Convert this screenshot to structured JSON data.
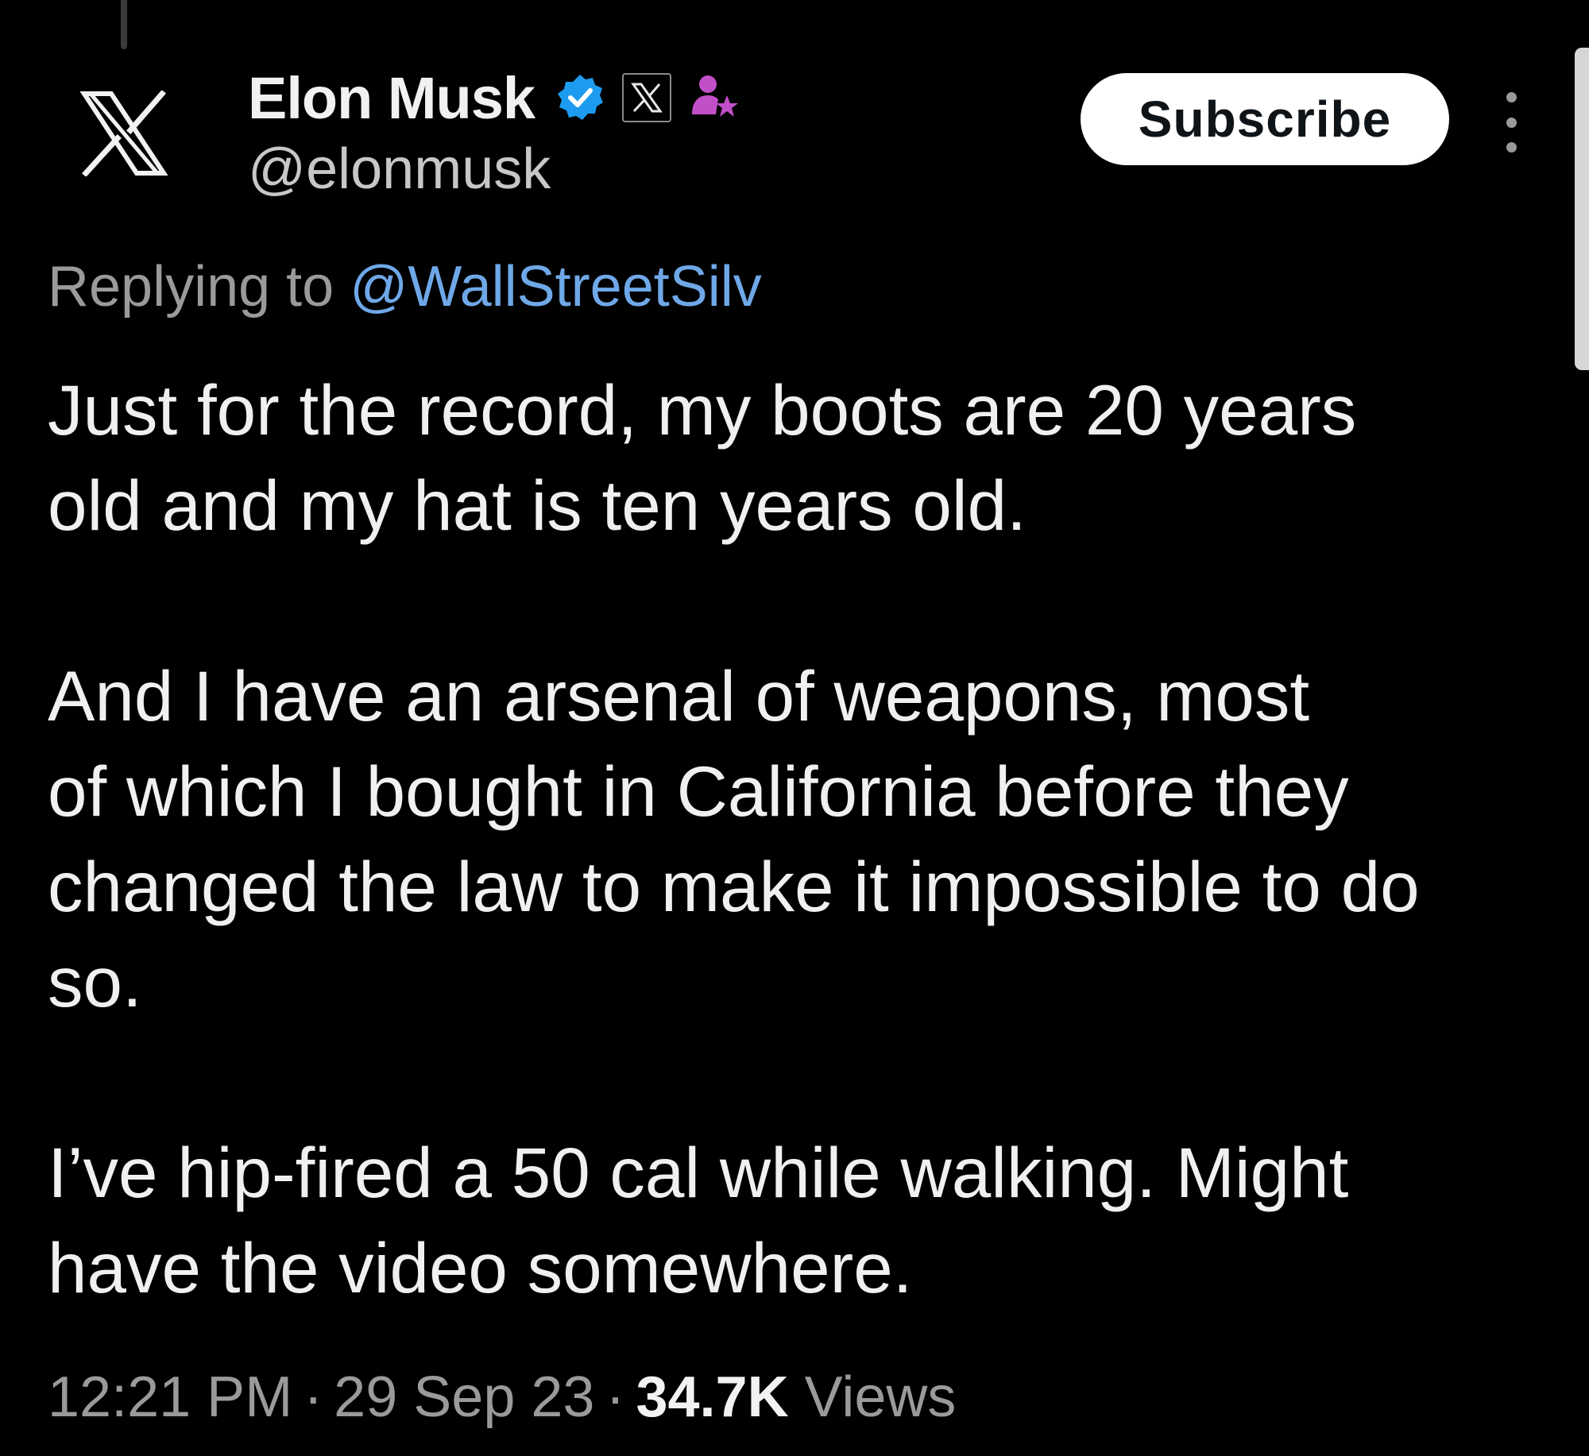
{
  "author": {
    "display_name": "Elon Musk",
    "handle": "@elonmusk",
    "avatar_icon": "x-logo-icon",
    "badges": [
      "verified-badge-icon",
      "affiliate-x-icon",
      "person-star-icon"
    ],
    "verified_color": "#1d9bf0",
    "role_icon_color": "#c14fc8"
  },
  "actions": {
    "subscribe_label": "Subscribe",
    "more_icon": "more-vertical-icon"
  },
  "reply": {
    "prefix": "Replying to",
    "handle": "@WallStreetSilv",
    "handle_color": "#6fa8e8"
  },
  "tweet": {
    "paragraphs": [
      [
        "Just for the record, my boots are 20 years",
        "old and my hat is ten years old."
      ],
      [
        "And I have an arsenal of weapons, most",
        "of which I bought in California before they",
        "changed the law to make it impossible to do",
        "so."
      ],
      [
        "I’ve hip-fired a 50 cal while walking. Might",
        "have the video somewhere."
      ]
    ]
  },
  "meta": {
    "time": "12:21 PM",
    "date": "29 Sep 23",
    "views_count": "34.7K",
    "views_label": "Views",
    "separator": "·"
  }
}
